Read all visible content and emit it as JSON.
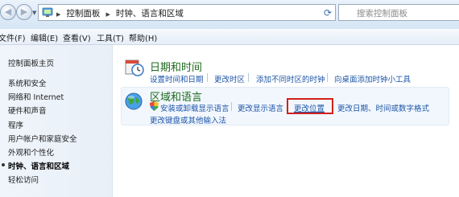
{
  "address_bar": {
    "breadcrumbs": [
      "控制面板",
      "时钟、语言和区域"
    ],
    "search_placeholder": "搜索控制面板"
  },
  "menu": [
    "文件(F)",
    "编辑(E)",
    "查看(V)",
    "工具(T)",
    "帮助(H)"
  ],
  "sidebar": {
    "home": "控制面板主页",
    "items": [
      "系统和安全",
      "网络和 Internet",
      "硬件和声音",
      "程序",
      "用户帐户和家庭安全",
      "外观和个性化",
      "时钟、语言和区域",
      "轻松访问"
    ],
    "active_index": 6
  },
  "categories": [
    {
      "title": "日期和时间",
      "links": [
        "设置时间和日期",
        "更改时区",
        "添加不同时区的时钟",
        "向桌面添加时钟小工具"
      ]
    },
    {
      "title": "区域和语言",
      "links": [
        "安装或卸载显示语言",
        "更改显示语言",
        "更改位置",
        "更改日期、时间或数字格式",
        "更改键盘或其他输入法"
      ]
    }
  ],
  "highlight_color": "#d4201b"
}
